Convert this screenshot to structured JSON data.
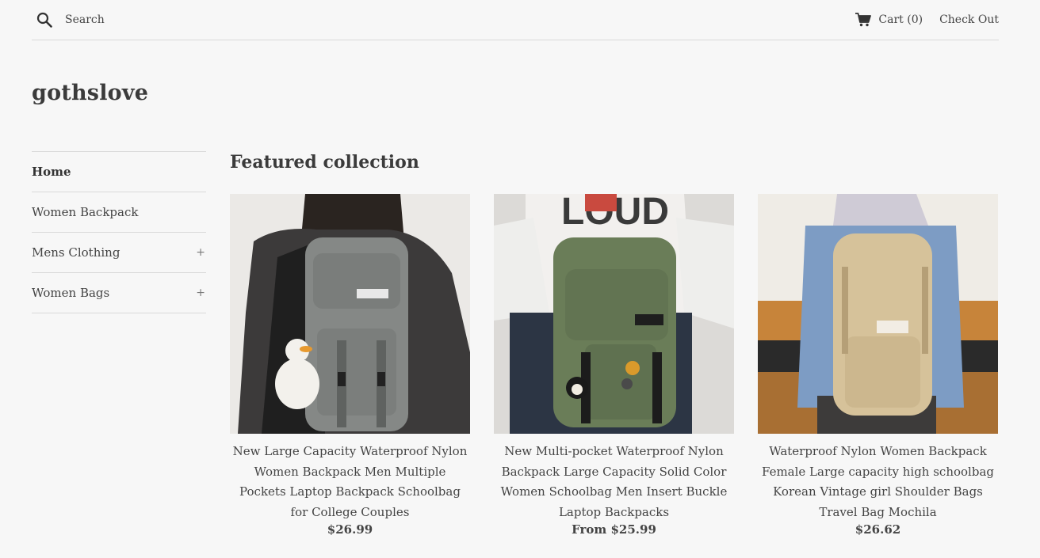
{
  "header": {
    "search_label": "Search",
    "cart_label": "Cart (0)",
    "checkout_label": "Check Out"
  },
  "store": {
    "name": "gothslove"
  },
  "sidebar": {
    "items": [
      {
        "label": "Home",
        "active": true,
        "expandable": false
      },
      {
        "label": "Women Backpack",
        "active": false,
        "expandable": false
      },
      {
        "label": "Mens Clothing",
        "active": false,
        "expandable": true,
        "toggle": "+"
      },
      {
        "label": "Women Bags",
        "active": false,
        "expandable": true,
        "toggle": "+"
      }
    ]
  },
  "main": {
    "section_title": "Featured collection",
    "products": [
      {
        "title": "New Large Capacity Waterproof Nylon Women Backpack Men Multiple Pockets Laptop Backpack Schoolbag for College Couples",
        "price": "$26.99",
        "bag_color": "#8a8d8b"
      },
      {
        "title": "New Multi-pocket Waterproof Nylon Backpack Large Capacity Solid Color Women Schoolbag Men Insert Buckle Laptop Backpacks",
        "price": "From $25.99",
        "bag_color": "#6a7d58"
      },
      {
        "title": "Waterproof Nylon Women Backpack Female Large capacity high schoolbag Korean Vintage girl Shoulder Bags Travel Bag Mochila",
        "price": "$26.62",
        "bag_color": "#d6c29a"
      }
    ]
  },
  "icons": {
    "search": "search-icon",
    "cart": "cart-icon",
    "expand": "plus-icon"
  }
}
